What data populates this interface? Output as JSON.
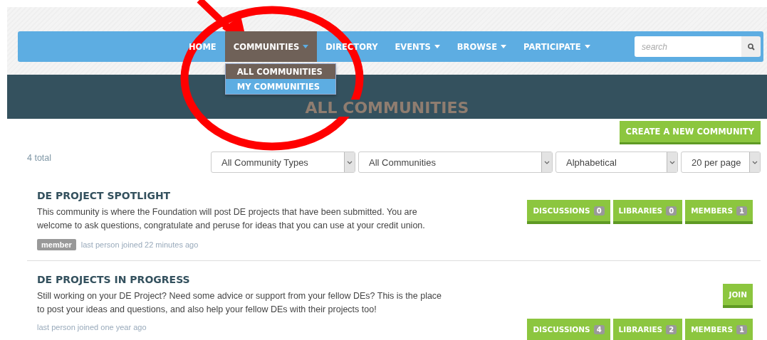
{
  "nav": {
    "items": [
      {
        "label": "HOME",
        "has_menu": false,
        "selected": false
      },
      {
        "label": "COMMUNITIES",
        "has_menu": true,
        "selected": true
      },
      {
        "label": "DIRECTORY",
        "has_menu": false,
        "selected": false
      },
      {
        "label": "EVENTS",
        "has_menu": true,
        "selected": false
      },
      {
        "label": "BROWSE",
        "has_menu": true,
        "selected": false
      },
      {
        "label": "PARTICIPATE",
        "has_menu": true,
        "selected": false
      }
    ],
    "dropdown": [
      {
        "label": "ALL COMMUNITIES",
        "selected": true
      },
      {
        "label": "MY COMMUNITIES",
        "selected": false
      }
    ],
    "search": {
      "placeholder": "search"
    }
  },
  "banner": {
    "title": "ALL COMMUNITIES"
  },
  "create_button": "CREATE A NEW COMMUNITY",
  "total": "4 total",
  "filters": [
    {
      "value": "All Community Types"
    },
    {
      "value": "All Communities"
    },
    {
      "value": "Alphabetical"
    },
    {
      "value": "20 per page"
    }
  ],
  "communities": [
    {
      "title": "DE PROJECT SPOTLIGHT",
      "description": "This community is where the Foundation will post DE projects that have been submitted. You are welcome to ask questions, congratulate and peruse for ideas that you can use at your credit union.",
      "member": true,
      "member_label": "member",
      "last_joined": "last person joined 22 minutes ago",
      "join": false,
      "stats": [
        {
          "label": "DISCUSSIONS",
          "count": "0"
        },
        {
          "label": "LIBRARIES",
          "count": "0"
        },
        {
          "label": "MEMBERS",
          "count": "1"
        }
      ]
    },
    {
      "title": "DE PROJECTS IN PROGRESS",
      "description": "Still working on your DE Project? Need some advice or support from your fellow DEs? This is the place to post your ideas and questions, and also help your fellow DEs with their projects too!",
      "member": false,
      "last_joined": "last person joined one year ago",
      "join": true,
      "join_label": "JOIN",
      "stats": [
        {
          "label": "DISCUSSIONS",
          "count": "4"
        },
        {
          "label": "LIBRARIES",
          "count": "2"
        },
        {
          "label": "MEMBERS",
          "count": "1"
        }
      ]
    }
  ]
}
